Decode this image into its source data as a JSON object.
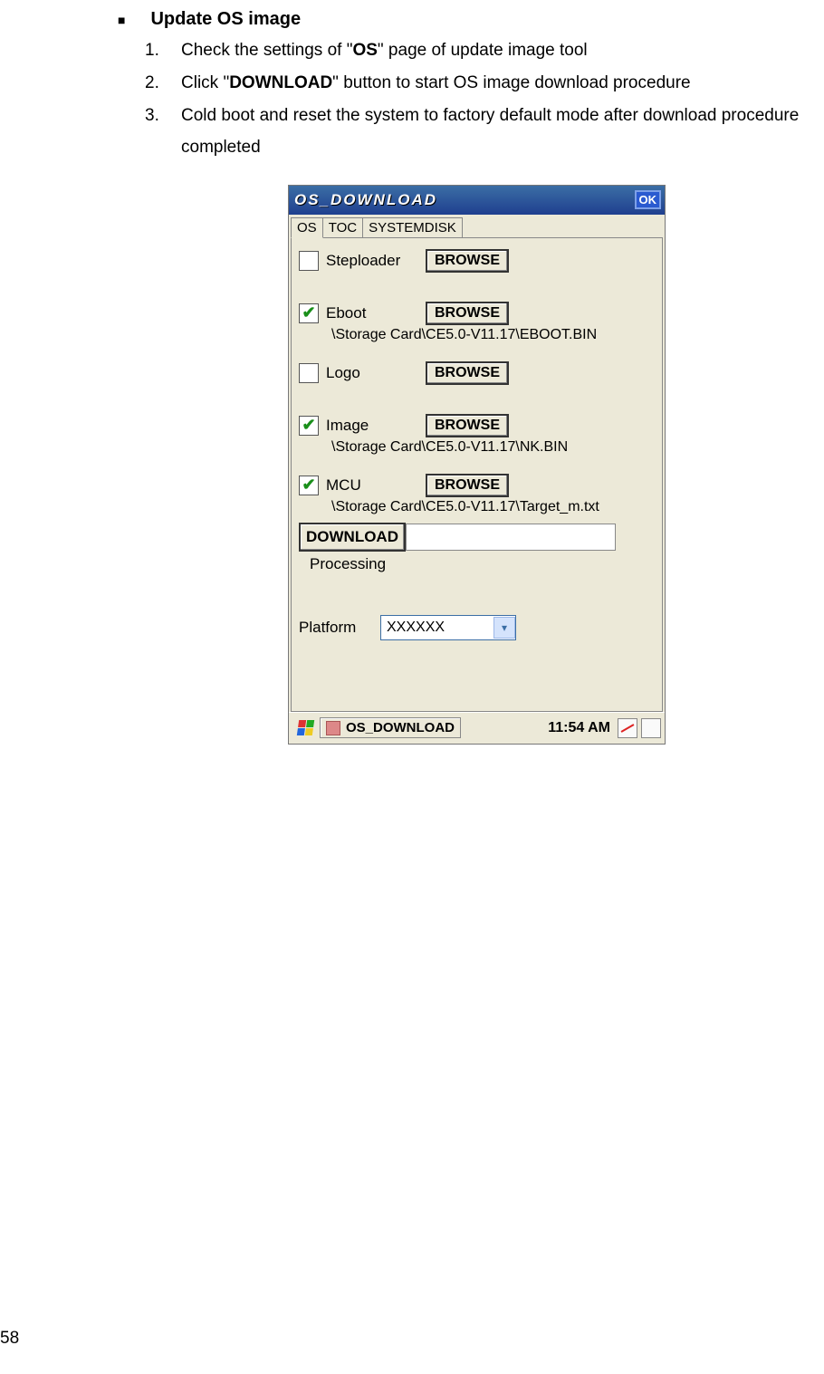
{
  "doc": {
    "heading": "Update OS image",
    "steps": [
      {
        "n": "1.",
        "pre": "Check the settings of \"",
        "bold": "OS",
        "post": "\" page of update image tool"
      },
      {
        "n": "2.",
        "pre": "Click \"",
        "bold": "DOWNLOAD",
        "post": "\" button to start OS image download procedure"
      },
      {
        "n": "3.",
        "pre": "Cold boot and reset the system to factory default mode after download procedure completed",
        "bold": "",
        "post": ""
      }
    ],
    "page_number": "58"
  },
  "win": {
    "title": "OS_DOWNLOAD",
    "ok": "OK",
    "tabs": [
      "OS",
      "TOC",
      "SYSTEMDISK"
    ],
    "rows": {
      "steploader": {
        "label": "Steploader",
        "checked": false,
        "browse": "BROWSE",
        "path": ""
      },
      "eboot": {
        "label": "Eboot",
        "checked": true,
        "browse": "BROWSE",
        "path": "\\Storage Card\\CE5.0-V11.17\\EBOOT.BIN"
      },
      "logo": {
        "label": "Logo",
        "checked": false,
        "browse": "BROWSE",
        "path": ""
      },
      "image": {
        "label": "Image",
        "checked": true,
        "browse": "BROWSE",
        "path": "\\Storage Card\\CE5.0-V11.17\\NK.BIN"
      },
      "mcu": {
        "label": "MCU",
        "checked": true,
        "browse": "BROWSE",
        "path": "\\Storage Card\\CE5.0-V11.17\\Target_m.txt"
      }
    },
    "download": "DOWNLOAD",
    "processing": "Processing",
    "platform_label": "Platform",
    "platform_value": "XXXXXX"
  },
  "taskbar": {
    "app": "OS_DOWNLOAD",
    "clock": "11:54 AM"
  }
}
